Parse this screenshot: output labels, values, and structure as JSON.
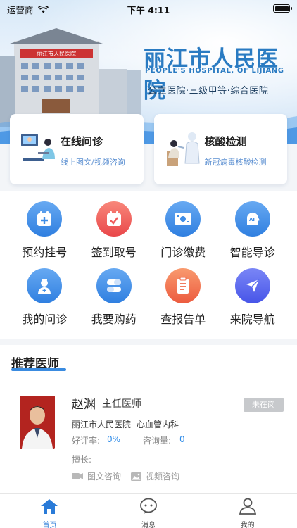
{
  "status_bar": {
    "carrier": "运营商",
    "time": "下午 4:11"
  },
  "banner": {
    "title_cn": "丽江市人民医院",
    "title_en": "PEOPLE'S HOSPITAL, OF LIJIANG",
    "subtitle": "公立医院·三级甲等·综合医院",
    "building_sign": "丽江市人民医院"
  },
  "service_cards": [
    {
      "title": "在线问诊",
      "subtitle": "线上图文/视频咨询"
    },
    {
      "title": "核酸检测",
      "subtitle": "新冠病毒核酸检测"
    }
  ],
  "grid": {
    "row1": [
      {
        "label": "预约挂号",
        "icon": "calendar-plus-icon",
        "color": "#3f8de6"
      },
      {
        "label": "签到取号",
        "icon": "calendar-check-icon",
        "color": "#ef5b5b"
      },
      {
        "label": "门诊缴费",
        "icon": "money-icon",
        "color": "#3f8de6"
      },
      {
        "label": "智能导诊",
        "icon": "ai-head-icon",
        "color": "#3f8de6"
      }
    ],
    "row2": [
      {
        "label": "我的问诊",
        "icon": "doctor-icon",
        "color": "#3f8de6"
      },
      {
        "label": "我要购药",
        "icon": "pill-icon",
        "color": "#3f8de6"
      },
      {
        "label": "查报告单",
        "icon": "report-icon",
        "color": "#ef6a4a"
      },
      {
        "label": "来院导航",
        "icon": "navigation-icon",
        "color": "#5a6cf0"
      }
    ]
  },
  "doctors_section": {
    "title": "推荐医师",
    "doctor": {
      "name": "赵渊",
      "title": "主任医师",
      "status": "未在岗",
      "hospital": "丽江市人民医院",
      "department": "心血管内科",
      "rating_label": "好评率:",
      "rating_value": "0%",
      "consult_label": "咨询量:",
      "consult_value": "0",
      "specialty_label": "擅长:",
      "service_text": "图文咨询",
      "service_video": "视频咨询"
    }
  },
  "tabbar": [
    {
      "label": "首页",
      "active": true
    },
    {
      "label": "消息",
      "active": false
    },
    {
      "label": "我的",
      "active": false
    }
  ],
  "colors": {
    "accent": "#2a7bd8",
    "brand_blue": "#2a7bc2",
    "status_gray": "#c7c9cc"
  }
}
